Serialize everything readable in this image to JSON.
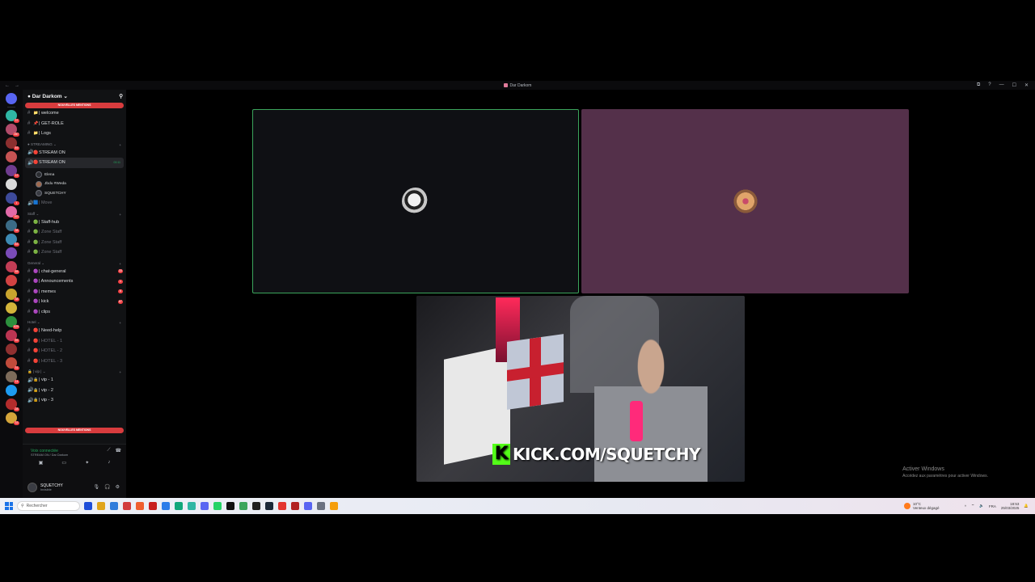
{
  "window": {
    "title": "Dar Darkom",
    "nav_back": "←",
    "nav_fwd": "→",
    "controls": [
      "⧉",
      "?",
      "—",
      "☐",
      "✕"
    ]
  },
  "server": {
    "name": "Dar Darkom",
    "mention_label": "NOUVELLES MENTIONS"
  },
  "rail": {
    "servers": [
      {
        "color": "#5865f2",
        "badge": ""
      },
      {
        "color": "#2fb6a4",
        "badge": "37"
      },
      {
        "color": "#b14b6a",
        "badge": "287"
      },
      {
        "color": "#8c2f2f",
        "badge": "49"
      },
      {
        "color": "#c65353",
        "badge": ""
      },
      {
        "color": "#6f3c8f",
        "badge": "12"
      },
      {
        "color": "#dadada",
        "badge": ""
      },
      {
        "color": "#3d4a9a",
        "badge": "1"
      },
      {
        "color": "#e36aa8",
        "badge": "101"
      },
      {
        "color": "#3b6b86",
        "badge": "38"
      },
      {
        "color": "#3d8ab3",
        "badge": "83"
      },
      {
        "color": "#7a4bb7",
        "badge": ""
      },
      {
        "color": "#c23d55",
        "badge": "55"
      },
      {
        "color": "#d24242",
        "badge": ""
      },
      {
        "color": "#c9a42e",
        "badge": "38"
      },
      {
        "color": "#d4b43a",
        "badge": ""
      },
      {
        "color": "#2c8f3d",
        "badge": "629"
      },
      {
        "color": "#bb3552",
        "badge": "59"
      },
      {
        "color": "#8f3030",
        "badge": ""
      },
      {
        "color": "#c04b3b",
        "badge": "31"
      },
      {
        "color": "#7d6b5a",
        "badge": "14"
      },
      {
        "color": "#1d9bf0",
        "badge": ""
      },
      {
        "color": "#b32c2c",
        "badge": "28"
      },
      {
        "color": "#d4a53a",
        "badge": "33"
      }
    ]
  },
  "channels_top": [
    {
      "icon": "#",
      "emoji": "📁",
      "name": "| welcome",
      "muted": false
    },
    {
      "icon": "#",
      "emoji": "📌",
      "name": "| GET-ROLE",
      "muted": false
    },
    {
      "icon": "#",
      "emoji": "📁",
      "name": "| Logs",
      "muted": false
    }
  ],
  "streaming": {
    "category": "STREAMING",
    "channels": [
      {
        "name": "STREAM ON",
        "muted": false
      },
      {
        "name": "STREAM ON",
        "active": true,
        "time": "00:11"
      }
    ],
    "sub_note": "Définir un statut de salon ✎",
    "voice_users": [
      {
        "name": "Elena",
        "color": "#2b2d31"
      },
      {
        "name": "Jbdu #Weda",
        "color": "#a06a4f"
      },
      {
        "name": "SQUETCHY",
        "color": "#3a3c43"
      }
    ],
    "extra": "| Move"
  },
  "staff": {
    "category": "Staff",
    "channels": [
      {
        "name": "| Staff-hub",
        "muted": false
      },
      {
        "name": "| Zone Staff",
        "muted": true
      },
      {
        "name": "| Zone Staff",
        "muted": true
      },
      {
        "name": "| Zone Staff",
        "muted": true
      }
    ]
  },
  "general": {
    "category": "General",
    "channels": [
      {
        "name": "| chat-general",
        "count": "33"
      },
      {
        "name": "| Announcements",
        "count": "1"
      },
      {
        "name": "| memes",
        "count": "6"
      },
      {
        "name": "| kick",
        "count": "67"
      },
      {
        "name": "| clips",
        "count": ""
      }
    ]
  },
  "hotel": {
    "category": "Hotel",
    "channels": [
      {
        "name": "| Need-help",
        "muted": false
      },
      {
        "name": "| HOTEL - 1",
        "muted": true
      },
      {
        "name": "| HOTEL - 2",
        "muted": true
      },
      {
        "name": "| HOTEL - 3",
        "muted": true
      }
    ]
  },
  "vip": {
    "category": "| vip |",
    "channels": [
      {
        "name": "| vip - 1"
      },
      {
        "name": "| vip - 2"
      },
      {
        "name": "| vip - 3"
      }
    ]
  },
  "voice_panel": {
    "status": "Voix connectée",
    "location": "STREAM ON / Dar Darkom"
  },
  "user": {
    "name": "SQUETCHY",
    "status": "Invisible"
  },
  "stage": {
    "kick_text": "KICK.COM/SQUETCHY",
    "kick_logo": "K",
    "activate_title": "Activer Windows",
    "activate_sub": "Accédez aux paramètres pour activer Windows."
  },
  "taskbar": {
    "search_placeholder": "Rechercher",
    "weather_temp": "10°C",
    "weather_desc": "Venteux dégagé",
    "lang": "FRA",
    "time": "18:53",
    "date": "25/03/2025",
    "apps": [
      "#1d4ed8",
      "#e0a41a",
      "#2f7ddb",
      "#d23c3c",
      "#ef5f2f",
      "#c81e1e",
      "#2b7de9",
      "#11a77a",
      "#2fb6a4",
      "#5865f2",
      "#25d366",
      "#111111",
      "#3ba55c",
      "#1f1f1f",
      "#1b2838",
      "#e3342f",
      "#b22222",
      "#5865f2",
      "#6b7280",
      "#f59e0b"
    ]
  },
  "colors": {
    "accent_green": "#3ba55c",
    "mention_red": "#d83c3e",
    "tile2": "#54304a"
  }
}
